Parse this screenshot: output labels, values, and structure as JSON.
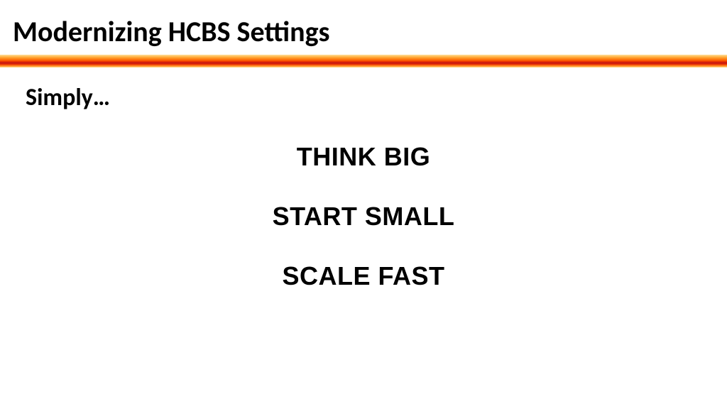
{
  "title": "Modernizing HCBS Settings",
  "subheading": "Simply…",
  "lines": {
    "line1": "THINK BIG",
    "line2": "START SMALL",
    "line3": "SCALE FAST"
  }
}
